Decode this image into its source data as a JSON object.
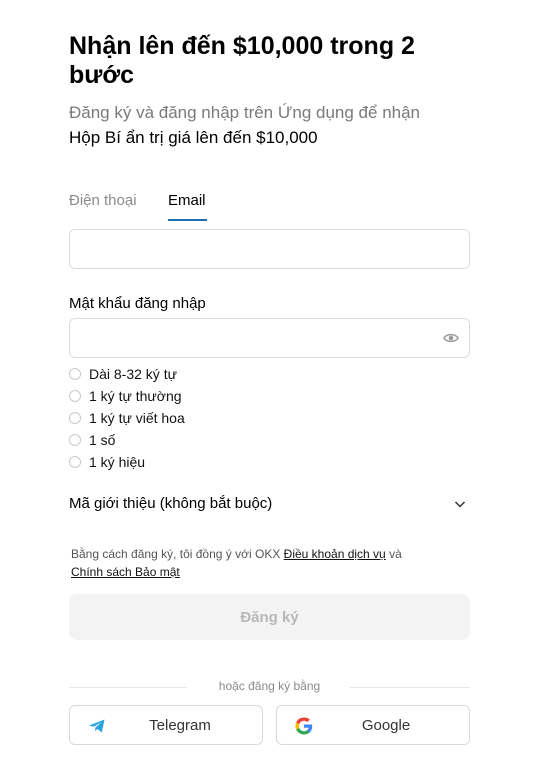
{
  "header": {
    "title": "Nhận lên đến $10,000 trong 2 bước",
    "subtitle_line1": "Đăng ký và đăng nhập trên Ứng dụng để nhận",
    "subtitle_line2": "Hộp Bí ẩn trị giá lên đến $10,000"
  },
  "tabs": [
    {
      "label": "Điện thoại",
      "active": false
    },
    {
      "label": "Email",
      "active": true
    }
  ],
  "email_field": {
    "value": "",
    "placeholder": ""
  },
  "password": {
    "label": "Mật khẩu đăng nhập",
    "value": "",
    "placeholder": "",
    "toggle_icon": "eye-icon"
  },
  "password_rules": [
    "Dài 8-32 ký tự",
    "1 ký tự thường",
    "1 ký tự viết hoa",
    "1 số",
    "1 ký hiệu"
  ],
  "referral": {
    "label": "Mã giới thiệu (không bắt buộc)",
    "icon": "chevron-down-icon"
  },
  "terms": {
    "prefix": "Bằng cách đăng ký, tôi đồng ý với OKX ",
    "link1": "Điều khoản dịch vụ",
    "middle": " và",
    "link2": "Chính sách Bảo mật"
  },
  "signup_button": {
    "label": "Đăng ký",
    "enabled": false
  },
  "divider_text": "hoặc đăng ký bằng",
  "social": [
    {
      "label": "Telegram",
      "icon": "telegram-icon",
      "color": "#2aa3df"
    },
    {
      "label": "Google",
      "icon": "google-icon"
    }
  ],
  "colors": {
    "accent": "#1a6fb3",
    "disabled_button_bg": "#f3f3f3",
    "disabled_button_text": "#b8b8b8"
  }
}
